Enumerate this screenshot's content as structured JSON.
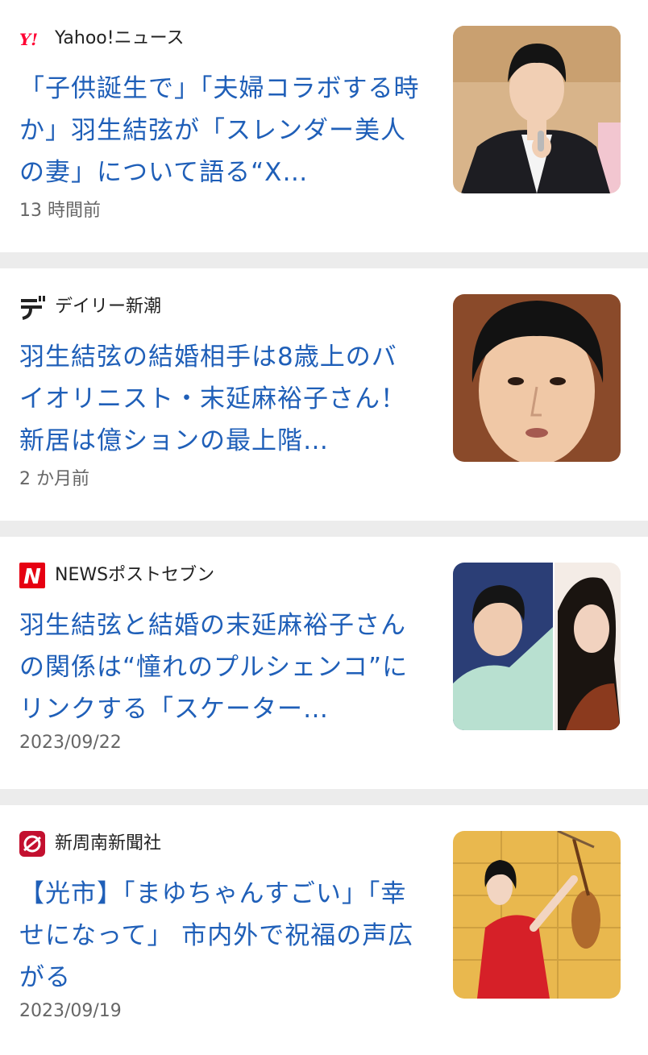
{
  "articles": [
    {
      "source": "Yahoo!ニュース",
      "logo_icon": "yahoo-logo-icon",
      "headline": "「子供誕生で」「夫婦コラボする時か」羽生結弦が「スレンダー美人の妻」について語る“X…",
      "time": "13 時間前",
      "thumbnail": "man-in-suit-with-microphone"
    },
    {
      "source": "デイリー新潮",
      "logo_icon": "daily-shincho-logo-icon",
      "headline": "羽生結弦の結婚相手は8歳上のバイオリニスト・末延麻裕子さん！ 新居は億ションの最上階…",
      "time": "2 か月前",
      "thumbnail": "man-face-closeup"
    },
    {
      "source": "NEWSポストセブン",
      "logo_icon": "news-post-seven-logo-icon",
      "headline": "羽生結弦と結婚の末延麻裕子さんの関係は“憧れのプルシェンコ”にリンクする「スケーター…",
      "time": "2023/09/22",
      "thumbnail": "skater-and-violinist-split"
    },
    {
      "source": "新周南新聞社",
      "logo_icon": "shin-shunan-logo-icon",
      "headline": "【光市】「まゆちゃんすごい」「幸せになって」 市内外で祝福の声広がる",
      "time": "2023/09/19",
      "thumbnail": "violinist-in-red-dress"
    }
  ],
  "colors": {
    "headline": "#1f5fb8",
    "yahoo_red": "#ff0033",
    "news_red": "#e60012",
    "shunan_red": "#c3102f"
  }
}
